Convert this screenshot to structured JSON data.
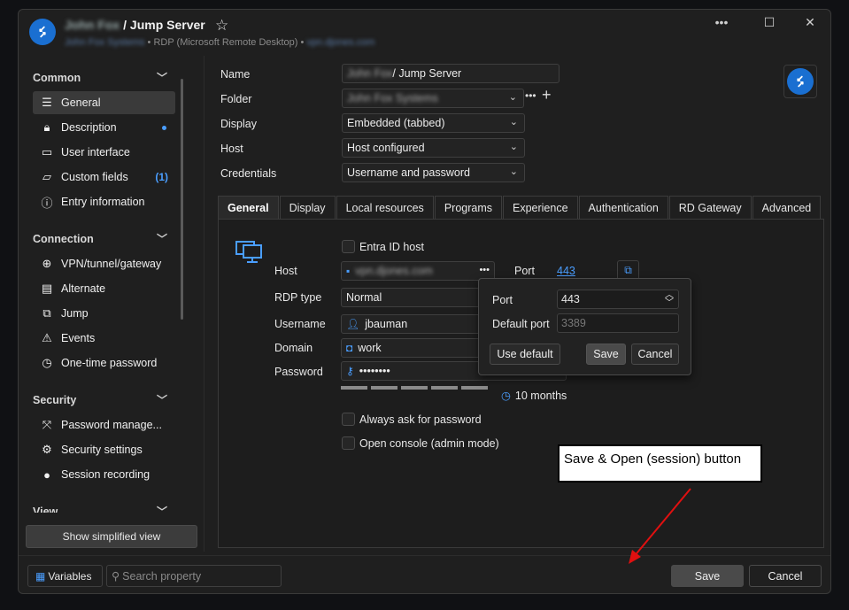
{
  "window": {
    "title_blurred": "John Fox",
    "title_rest": " / Jump Server",
    "subtitle_blurred": "John Fox Systems",
    "subtitle_mid": " • RDP (Microsoft Remote Desktop) • ",
    "subtitle_host_blurred": "vpn.djones.com",
    "controls": [
      "•••",
      "☐",
      "✕"
    ]
  },
  "sidebar": {
    "sections": [
      {
        "title": "Common",
        "items": [
          {
            "label": "General",
            "icon": "list-icon"
          },
          {
            "label": "Description",
            "icon": "lock-icon"
          },
          {
            "label": "User interface",
            "icon": "monitor-icon"
          },
          {
            "label": "Custom fields",
            "icon": "tag-icon",
            "badge": "(1)"
          },
          {
            "label": "Entry information",
            "icon": "info-icon"
          }
        ]
      },
      {
        "title": "Connection",
        "items": [
          {
            "label": "VPN/tunnel/gateway",
            "icon": "globe-icon"
          },
          {
            "label": "Alternate",
            "icon": "document-icon"
          },
          {
            "label": "Jump",
            "icon": "jump-icon"
          },
          {
            "label": "Events",
            "icon": "warning-icon"
          },
          {
            "label": "One-time password",
            "icon": "clock-icon"
          }
        ]
      },
      {
        "title": "Security",
        "items": [
          {
            "label": "Password manage...",
            "icon": "password-manager-icon"
          },
          {
            "label": "Security settings",
            "icon": "gear-shield-icon"
          },
          {
            "label": "Session recording",
            "icon": "record-icon"
          }
        ]
      },
      {
        "title": "View",
        "items": []
      }
    ],
    "simplified_button": "Show simplified view"
  },
  "form": {
    "name_label": "Name",
    "name_blurred": "John Fox",
    "name_rest": " / Jump Server",
    "folder_label": "Folder",
    "folder_blurred": "John Fox Systems",
    "display_label": "Display",
    "display_value": "Embedded (tabbed)",
    "host_label": "Host",
    "host_value": "Host configured",
    "credentials_label": "Credentials",
    "credentials_value": "Username and password"
  },
  "tabs": [
    "General",
    "Display",
    "Local resources",
    "Programs",
    "Experience",
    "Authentication",
    "RD Gateway",
    "Advanced"
  ],
  "general": {
    "entra_label": "Entra ID host",
    "host_label": "Host",
    "host_blurred": "vpn.djones.com",
    "port_label": "Port",
    "port_value": "443",
    "rdp_type_label": "RDP type",
    "rdp_type_value": "Normal",
    "username_label": "Username",
    "username_value": "jbauman",
    "domain_label": "Domain",
    "domain_value": "work",
    "password_label": "Password",
    "password_value": "••••••••",
    "password_age": "10 months",
    "always_ask_label": "Always ask for password",
    "open_console_label": "Open console (admin mode)"
  },
  "port_popup": {
    "port_label": "Port",
    "port_value": "443",
    "default_label": "Default port",
    "default_placeholder": "3389",
    "use_default": "Use default",
    "save": "Save",
    "cancel": "Cancel"
  },
  "bottom": {
    "variables": "Variables",
    "search_placeholder": "Search property",
    "save": "Save",
    "cancel": "Cancel"
  },
  "annotation": {
    "text": "Save & Open (session) button",
    "arrow_color": "#e01010"
  }
}
